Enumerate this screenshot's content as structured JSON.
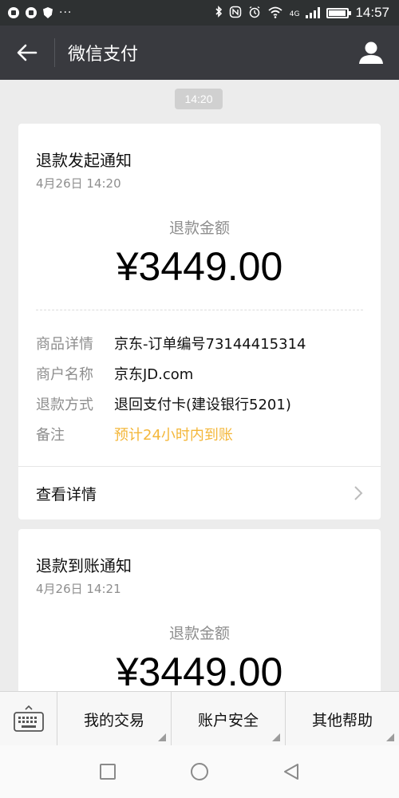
{
  "status_bar": {
    "time": "14:57",
    "network": "4G",
    "more": "···"
  },
  "app_bar": {
    "title": "微信支付"
  },
  "chat": {
    "time_stamp": "14:20"
  },
  "cards": [
    {
      "title": "退款发起通知",
      "date": "4月26日  14:20",
      "amount_label": "退款金额",
      "amount": "¥3449.00",
      "details": [
        {
          "key": "商品详情",
          "value": "京东-订单编号73144415314"
        },
        {
          "key": "商户名称",
          "value": "京东JD.com"
        },
        {
          "key": "退款方式",
          "value": "退回支付卡(建设银行5201)"
        },
        {
          "key": "备注",
          "value": "预计24小时内到账"
        }
      ],
      "remark_color": "#f4b73a",
      "view_detail": "查看详情"
    },
    {
      "title": "退款到账通知",
      "date": "4月26日  14:21",
      "amount_label": "退款金额",
      "amount": "¥3449.00"
    }
  ],
  "bottom_menu": {
    "items": [
      "我的交易",
      "账户安全",
      "其他帮助"
    ]
  },
  "colors": {
    "app_bar": "#393a3f",
    "status_bar": "#2e3132",
    "background": "#ececec",
    "highlight": "#f4b73a"
  },
  "icons": {
    "back": "arrow-left-icon",
    "profile": "person-icon",
    "keyboard": "keyboard-icon",
    "chevron": "chevron-right-icon"
  }
}
